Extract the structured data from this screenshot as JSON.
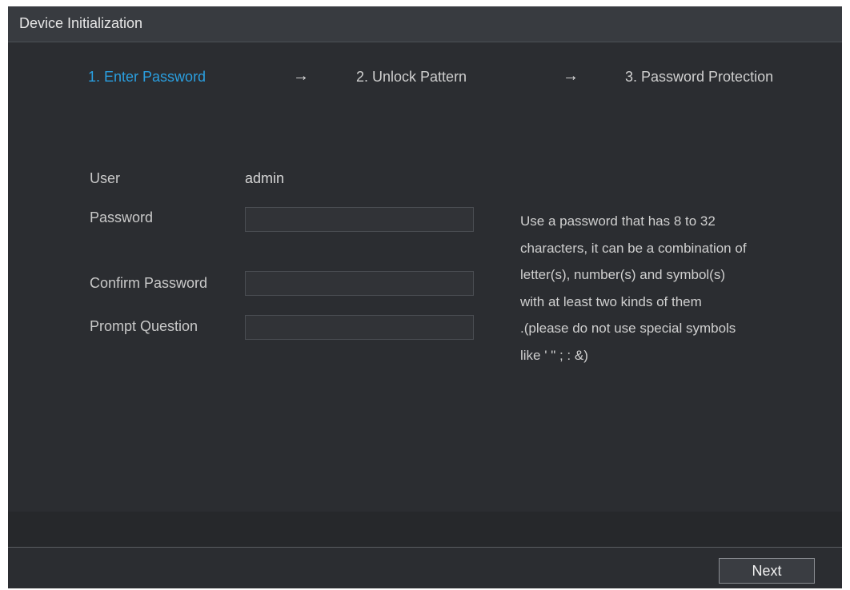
{
  "window": {
    "title": "Device Initialization"
  },
  "steps": [
    {
      "label": "1.  Enter Password",
      "active": true
    },
    {
      "label": "2.  Unlock Pattern",
      "active": false
    },
    {
      "label": "3.  Password Protection",
      "active": false
    }
  ],
  "step_arrow": "→",
  "form": {
    "user_label": "User",
    "user_value": "admin",
    "password_label": "Password",
    "password_value": "",
    "confirm_label": "Confirm Password",
    "confirm_value": "",
    "prompt_label": "Prompt Question",
    "prompt_value": ""
  },
  "hint_lines": [
    "Use a password that has 8 to 32",
    "characters, it can be a combination of",
    "letter(s), number(s) and symbol(s)",
    "with at least two kinds of them",
    ".(please do not use special symbols",
    "like ' \" ; : &)"
  ],
  "footer": {
    "next_label": "Next"
  },
  "colors": {
    "accent": "#2a9fe0",
    "background": "#2b2d31",
    "titlebar": "#383b40"
  }
}
